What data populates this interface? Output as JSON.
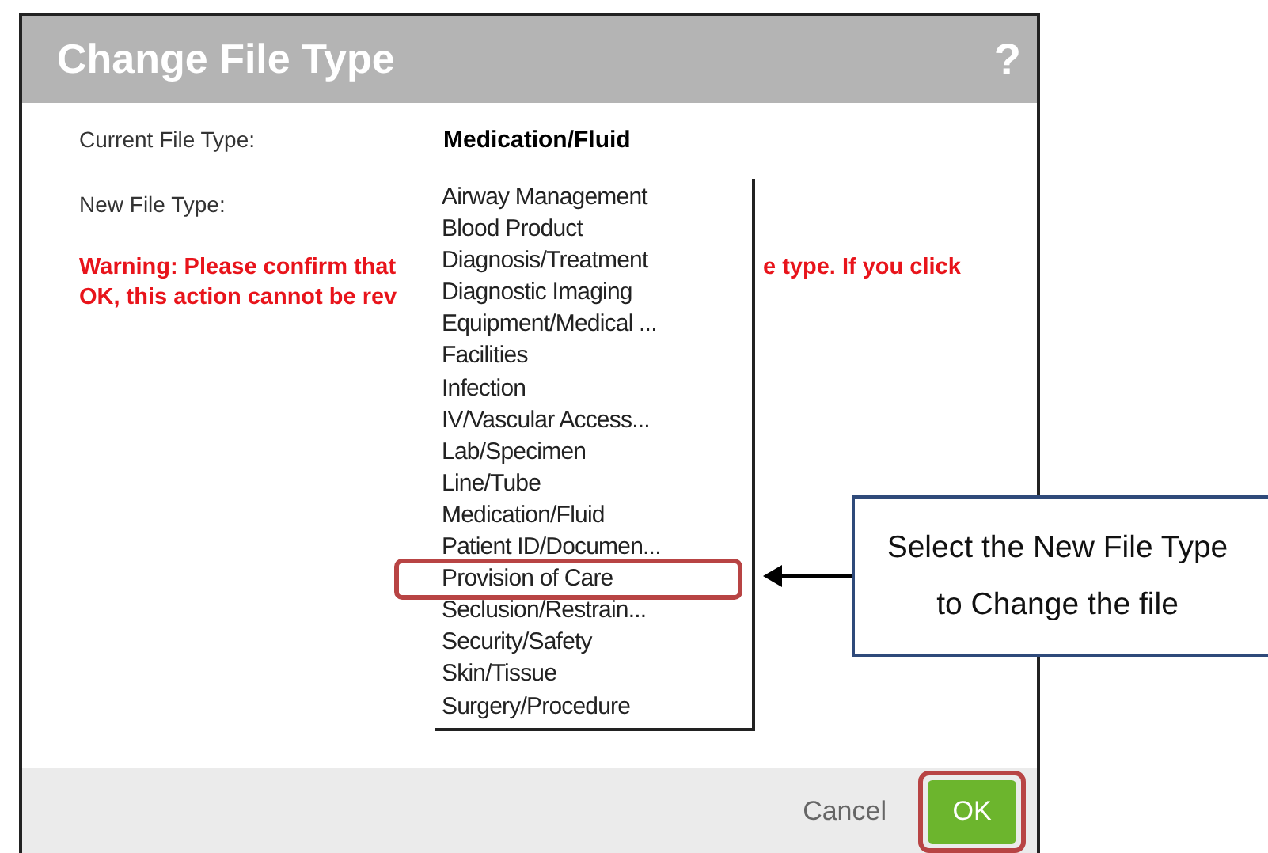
{
  "dialog": {
    "title": "Change File Type",
    "help": "?",
    "current_label": "Current File Type:",
    "current_value": "Medication/Fluid",
    "new_label": "New File Type:",
    "warning_lines": [
      {
        "left": "Warning: Please confirm that",
        "right": "e type. If you click"
      },
      {
        "left": "OK, this action cannot be rev"
      }
    ],
    "buttons": [
      {
        "label": "Cancel",
        "kind": "link",
        "highlighted": false
      },
      {
        "label": "OK",
        "kind": "primary",
        "highlighted": true
      }
    ]
  },
  "dropdown": {
    "items": [
      {
        "label": "Airway Management",
        "highlighted": false
      },
      {
        "label": "Blood Product",
        "highlighted": false
      },
      {
        "label": "Diagnosis/Treatment",
        "highlighted": false
      },
      {
        "label": "Diagnostic Imaging",
        "highlighted": false
      },
      {
        "label": "Equipment/Medical ...",
        "highlighted": false
      },
      {
        "label": "Facilities",
        "highlighted": false
      },
      {
        "label": "Infection",
        "highlighted": false
      },
      {
        "label": "IV/Vascular Access...",
        "highlighted": false
      },
      {
        "label": "Lab/Specimen",
        "highlighted": false
      },
      {
        "label": "Line/Tube",
        "highlighted": false
      },
      {
        "label": "Medication/Fluid",
        "highlighted": false
      },
      {
        "label": "Patient ID/Documen...",
        "highlighted": false
      },
      {
        "label": "Provision of Care",
        "highlighted": true
      },
      {
        "label": "Seclusion/Restrain...",
        "highlighted": false
      },
      {
        "label": "Security/Safety",
        "highlighted": false
      },
      {
        "label": "Skin/Tissue",
        "highlighted": false
      },
      {
        "label": "Surgery/Procedure",
        "highlighted": false
      }
    ]
  },
  "callout": {
    "text": "Select the New File Type to Change the file"
  }
}
